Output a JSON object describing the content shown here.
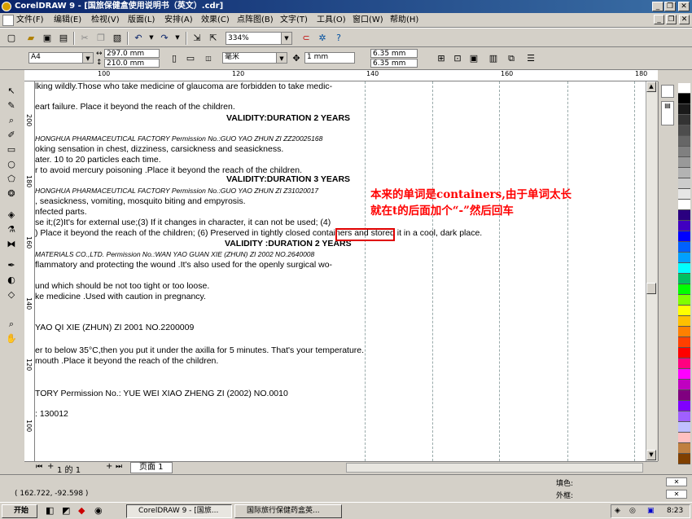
{
  "window": {
    "title": "CorelDRAW 9 - [国旅保健盒使用说明书（英文）.cdr]",
    "minimize": "_",
    "restore": "❐",
    "close": "✕"
  },
  "menu": [
    "文件(F)",
    "编辑(E)",
    "检视(V)",
    "版面(L)",
    "安排(A)",
    "效果(C)",
    "点阵图(B)",
    "文字(T)",
    "工具(O)",
    "窗口(W)",
    "帮助(H)"
  ],
  "toolbar": {
    "zoom": "334%"
  },
  "propbar": {
    "page_size": "A4",
    "width": "297.0 mm",
    "height": "210.0 mm",
    "units": "毫米",
    "nudge": "1 mm",
    "dup_x": "6.35 mm",
    "dup_y": "6.35 mm"
  },
  "ruler": {
    "h": [
      "100",
      "120",
      "140",
      "160",
      "180"
    ],
    "v": [
      "200",
      "180",
      "160",
      "140",
      "120",
      "100"
    ]
  },
  "canvas": {
    "lines": [
      "lking wildly.Those who take medicine of glaucoma are forbidden to take medic-",
      "eart failure. Place it beyond the reach of the children.",
      "VALIDITY:DURATION 2 YEARS",
      "HONGHUA PHARMACEUTICAL FACTORY  Permission No.:GUO YAO ZHUN ZI ZZ20025168",
      "oking sensation in chest, dizziness, carsickness and seasickness.",
      "ater. 10 to 20 particles each time.",
      "r to avoid mercury poisoning .Place it beyond the reach of the children.",
      "VALIDITY:DURATION 3 YEARS",
      "HONGHUA PHARMACEUTICAL FACTORY  Permission No.:GUO YAO ZHUN ZI Z31020017",
      ", seasickness, vomiting, mosquito biting and empyrosis.",
      "nfected parts.",
      "se it;(2)It's for external use;(3) If it changes in character, it can not be used; (4)",
      ") Place it beyond the reach of the children; (6) Preserved in tightly closed containers and stored it in a cool, dark place.",
      "VALIDITY :DURATION 2 YEARS",
      "MATERIALS CO.,LTD.  Permission No.:WAN YAO GUAN XIE (ZHUN) ZI  2002 NO.2640008",
      "flammatory and protecting the wound .It's also used for the openly surgical wo-",
      "und which should be not too tight or too loose.",
      "ke medicine .Used with caution in pregnancy.",
      "YAO QI XIE (ZHUN) ZI 2001 NO.2200009",
      "er to below 35°C,then you put it under the axilla for 5 minutes. That's your temperature.",
      "mouth .Place it beyond the reach of the children.",
      "TORY  Permission No.: YUE WEI XIAO ZHENG ZI (2002) NO.0010",
      ": 130012"
    ]
  },
  "annotation": {
    "line1": "本来的单词是containers,由于单词太长",
    "line2": "就在t的后面加个“-”然后回车"
  },
  "page_nav": {
    "info": "1 的 1",
    "tab": "页面  1"
  },
  "status": {
    "coords": "( 162.722, -92.598 )",
    "fill_label": "填色:",
    "outline_label": "外框:"
  },
  "taskbar": {
    "start": "开始",
    "task1": "CorelDRAW 9 - [国旅...",
    "task2": "国际旅行保健药盒英...",
    "clock": "8:23"
  },
  "palette": [
    "#ffffff",
    "#000000",
    "#1a1a1a",
    "#333333",
    "#4d4d4d",
    "#666666",
    "#808080",
    "#999999",
    "#b3b3b3",
    "#cccccc",
    "#e6e6e6",
    "#ffffff",
    "#2a0080",
    "#4000c0",
    "#0000ff",
    "#0060ff",
    "#00a0ff",
    "#00ffff",
    "#00c060",
    "#00ff00",
    "#80ff00",
    "#ffff00",
    "#ffc000",
    "#ff8000",
    "#ff4000",
    "#ff0000",
    "#ff0080",
    "#ff00ff",
    "#c000c0",
    "#800080",
    "#8000ff",
    "#a060ff",
    "#c0c0ff",
    "#ffc0c0",
    "#c08040",
    "#804000"
  ]
}
